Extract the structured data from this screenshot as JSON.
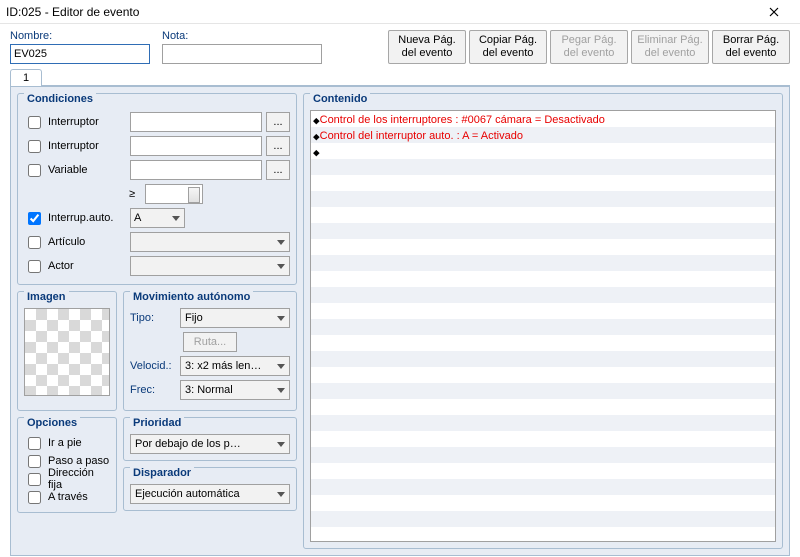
{
  "window": {
    "title": "ID:025 - Editor de evento"
  },
  "fields": {
    "name_label": "Nombre:",
    "name_value": "EV025",
    "note_label": "Nota:",
    "note_value": ""
  },
  "page_buttons": {
    "new": "Nueva Pág. del evento",
    "copy": "Copiar Pág. del evento",
    "paste": "Pegar Pág. del evento",
    "delete": "Eliminar Pág. del evento",
    "clear": "Borrar Pág. del evento"
  },
  "tabs": {
    "t1": "1"
  },
  "conditions": {
    "title": "Condiciones",
    "switch1": "Interruptor",
    "switch2": "Interruptor",
    "variable": "Variable",
    "geq": "≥",
    "selfswitch": "Interrup.auto.",
    "selfswitch_val": "A",
    "item": "Artículo",
    "actor": "Actor",
    "ellipsis": "..."
  },
  "image": {
    "title": "Imagen"
  },
  "movement": {
    "title": "Movimiento autónomo",
    "type_label": "Tipo:",
    "type_value": "Fijo",
    "route_btn": "Ruta...",
    "speed_label": "Velocid.:",
    "speed_value": "3: x2 más len…",
    "freq_label": "Frec:",
    "freq_value": "3: Normal"
  },
  "options": {
    "title": "Opciones",
    "walk": "Ir a pie",
    "step": "Paso a paso",
    "dirfix": "Dirección fija",
    "through": "A través"
  },
  "priority": {
    "title": "Prioridad",
    "value": "Por debajo de los p…"
  },
  "trigger": {
    "title": "Disparador",
    "value": "Ejecución automática"
  },
  "content": {
    "title": "Contenido",
    "lines": [
      "Control de los interruptores : #0067 cámara = Desactivado",
      "Control del interruptor auto. : A = Activado"
    ]
  }
}
